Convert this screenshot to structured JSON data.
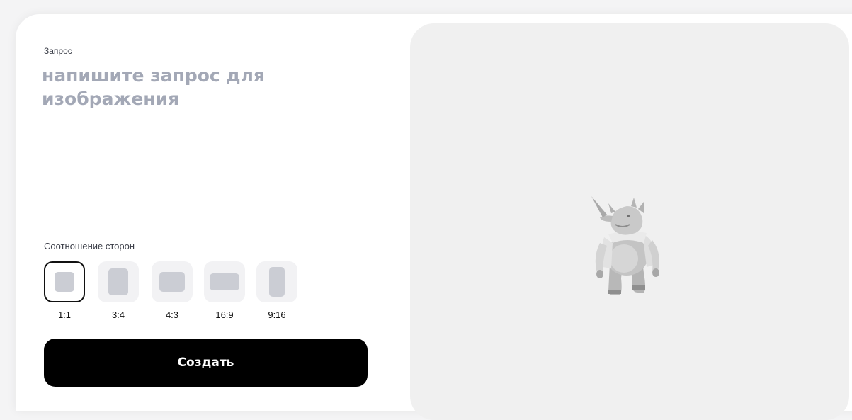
{
  "prompt": {
    "label": "Запрос",
    "placeholder": "напишите запрос для изображения"
  },
  "aspect_ratio": {
    "label": "Соотношение сторон",
    "selected": "1:1",
    "options": [
      {
        "label": "1:1"
      },
      {
        "label": "3:4"
      },
      {
        "label": "4:3"
      },
      {
        "label": "16:9"
      },
      {
        "label": "9:16"
      }
    ]
  },
  "create_button": {
    "label": "Создать"
  },
  "preview": {
    "image": "rhino-in-jacket-illustration"
  },
  "colors": {
    "button_bg": "#000000",
    "placeholder": "#a3a8b6",
    "preview_bg": "#f0f0f0",
    "ratio_tile": "#f2f2f4",
    "ratio_shape": "#cbcdd4"
  }
}
